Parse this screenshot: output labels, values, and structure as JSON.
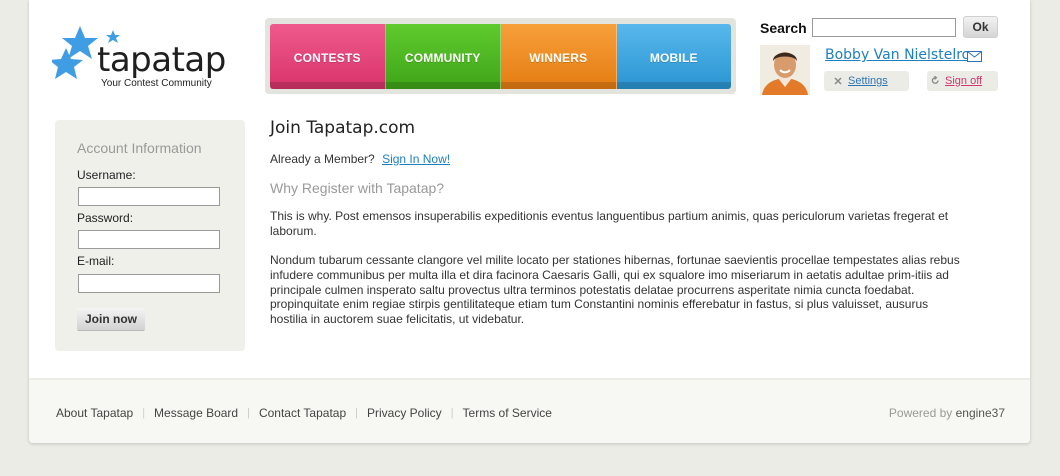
{
  "brand": {
    "name": "tapatap",
    "tagline": "Your Contest Community"
  },
  "nav": [
    {
      "label": "CONTESTS"
    },
    {
      "label": "COMMUNITY"
    },
    {
      "label": "WINNERS"
    },
    {
      "label": "MOBILE"
    }
  ],
  "search": {
    "label": "Search",
    "value": "",
    "button": "Ok"
  },
  "user": {
    "name": "Bobby Van Nielstelroy",
    "settings": "Settings",
    "signoff": "Sign off"
  },
  "sidebar": {
    "title": "Account Information",
    "username_label": "Username:",
    "password_label": "Password:",
    "email_label": "E-mail:",
    "username_value": "",
    "password_value": "",
    "email_value": "",
    "submit": "Join now"
  },
  "main": {
    "title": "Join Tapatap.com",
    "member_question": "Already a Member?",
    "signin_link": "Sign In Now!",
    "why_title": "Why Register with Tapatap?",
    "para1": "This is why. Post emensos insuperabilis expeditionis eventus languentibus partium animis, quas periculorum varietas fregerat et laborum.",
    "para2": "Nondum tubarum cessante clangore vel milite locato per stationes hibernas, fortunae saevientis procellae tempestates alias rebus infudere communibus per multa illa et dira facinora Caesaris Galli, qui ex squalore imo miseriarum in aetatis adultae prim-itiis ad principale culmen insperato saltu provectus ultra terminos potestatis delatae procurrens asperitate nimia cuncta foedabat. propinquitate enim regiae stirpis gentilitateque etiam tum Constantini nominis efferebatur in fastus, si plus valuisset, ausurus hostilia in auctorem suae felicitatis, ut videbatur."
  },
  "footer": {
    "links": [
      "About Tapatap",
      "Message Board",
      "Contact Tapatap",
      "Privacy Policy",
      "Terms of Service"
    ],
    "powered_prefix": "Powered by",
    "powered_brand": "engine37"
  },
  "colors": {
    "contests": "#e2417a",
    "community": "#4eb622",
    "winners": "#ee8b22",
    "mobile": "#3da6df",
    "link": "#1e7fc0",
    "signoff": "#d23670"
  }
}
